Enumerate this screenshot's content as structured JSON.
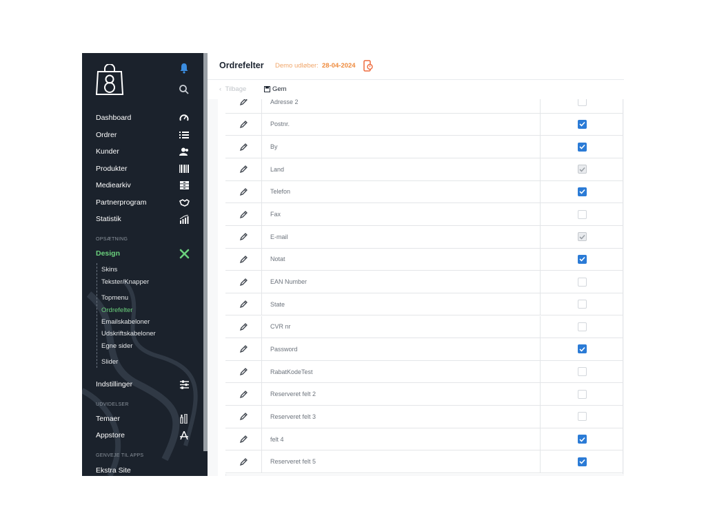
{
  "sidebar": {
    "nav": [
      {
        "label": "Dashboard",
        "icon": "speedometer-icon"
      },
      {
        "label": "Ordrer",
        "icon": "list-icon"
      },
      {
        "label": "Kunder",
        "icon": "users-icon"
      },
      {
        "label": "Produkter",
        "icon": "barcode-icon"
      },
      {
        "label": "Mediearkiv",
        "icon": "archive-icon"
      },
      {
        "label": "Partnerprogram",
        "icon": "handshake-icon"
      },
      {
        "label": "Statistik",
        "icon": "chart-icon"
      }
    ],
    "setup_label": "OPSÆTNING",
    "design": {
      "label": "Design",
      "icon": "design-tools-icon"
    },
    "design_sub": [
      {
        "label": "Skins",
        "active": false
      },
      {
        "label": "Tekster/Knapper",
        "active": false
      },
      {
        "label": "Topmenu",
        "active": false
      },
      {
        "label": "Ordrefelter",
        "active": true
      },
      {
        "label": "Emailskabeloner",
        "active": false
      },
      {
        "label": "Udskriftskabeloner",
        "active": false
      },
      {
        "label": "Egne sider",
        "active": false
      },
      {
        "label": "Slider",
        "active": false
      }
    ],
    "settings": {
      "label": "Indstillinger",
      "icon": "sliders-icon"
    },
    "extensions_label": "UDVIDELSER",
    "themes": {
      "label": "Temaer",
      "icon": "brushes-icon"
    },
    "appstore": {
      "label": "Appstore",
      "icon": "appstore-icon"
    },
    "shortcuts_label": "GENVEJE TIL APPS",
    "extra_site": {
      "label": "Ekstra Site"
    }
  },
  "header": {
    "title": "Ordrefelter",
    "demo_label": "Demo udløber:",
    "demo_date": "28-04-2024"
  },
  "toolbar": {
    "back_label": "Tilbage",
    "save_label": "Gem"
  },
  "fields": [
    {
      "name": "Adresse 2",
      "checked": false,
      "disabled": false
    },
    {
      "name": "Postnr.",
      "checked": true,
      "disabled": false
    },
    {
      "name": "By",
      "checked": true,
      "disabled": false
    },
    {
      "name": "Land",
      "checked": true,
      "disabled": true
    },
    {
      "name": "Telefon",
      "checked": true,
      "disabled": false
    },
    {
      "name": "Fax",
      "checked": false,
      "disabled": false
    },
    {
      "name": "E-mail",
      "checked": true,
      "disabled": true
    },
    {
      "name": "Notat",
      "checked": true,
      "disabled": false
    },
    {
      "name": "EAN Number",
      "checked": false,
      "disabled": false
    },
    {
      "name": "State",
      "checked": false,
      "disabled": false
    },
    {
      "name": "CVR nr",
      "checked": false,
      "disabled": false
    },
    {
      "name": "Password",
      "checked": true,
      "disabled": false
    },
    {
      "name": "RabatKodeTest",
      "checked": false,
      "disabled": false
    },
    {
      "name": "Reserveret felt 2",
      "checked": false,
      "disabled": false
    },
    {
      "name": "Reserveret felt 3",
      "checked": false,
      "disabled": false
    },
    {
      "name": "felt 4",
      "checked": true,
      "disabled": false
    },
    {
      "name": "Reserveret felt 5",
      "checked": true,
      "disabled": false
    }
  ],
  "colors": {
    "sidebar_bg": "#1b222c",
    "active_green": "#6bd17d",
    "checkbox_blue": "#2b7bd6",
    "demo_orange": "#ee8a3c"
  }
}
